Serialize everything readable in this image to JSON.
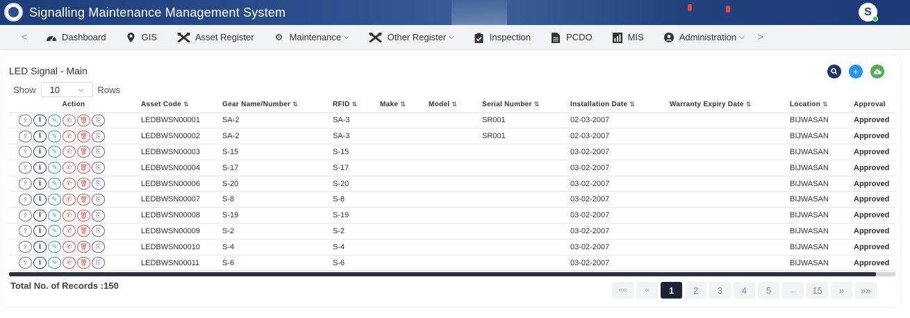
{
  "header": {
    "title": "Signalling Maintenance Management System",
    "avatar_letter": "S"
  },
  "nav": {
    "items": [
      {
        "label": "Dashboard",
        "icon": "dashboard-icon",
        "has_dropdown": false
      },
      {
        "label": "GIS",
        "icon": "map-pin-icon",
        "has_dropdown": false
      },
      {
        "label": "Asset Register",
        "icon": "tools-icon",
        "has_dropdown": false
      },
      {
        "label": "Maintenance",
        "icon": "gear-icon",
        "has_dropdown": true
      },
      {
        "label": "Other Register",
        "icon": "tools-icon",
        "has_dropdown": true
      },
      {
        "label": "Inspection",
        "icon": "clipboard-check-icon",
        "has_dropdown": false
      },
      {
        "label": "PCDO",
        "icon": "file-icon",
        "has_dropdown": false
      },
      {
        "label": "MIS",
        "icon": "report-icon",
        "has_dropdown": false
      },
      {
        "label": "Administration",
        "icon": "user-circle-icon",
        "has_dropdown": true
      }
    ],
    "prev_arrow": "<",
    "next_arrow": ">"
  },
  "panel": {
    "title": "LED Signal - Main",
    "show_label": "Show",
    "rows_label": "Rows",
    "rows_value": "10"
  },
  "colors": {
    "search_button": "#1d3768",
    "add_button": "#2196f3",
    "upload_button": "#4caf50",
    "approved": "#31c13c",
    "header_bg": "#2b4f8e"
  },
  "table": {
    "columns": [
      "Action",
      "Asset Code",
      "Gear Name/Number",
      "RFID",
      "Make",
      "Model",
      "Serial Number",
      "Installation Date",
      "Warranty Expiry Date",
      "Location",
      "Approval"
    ],
    "rows": [
      {
        "asset_code": "LEDBWSN00001",
        "gear": "SA-2",
        "rfid": "SA-3",
        "make": "",
        "model": "",
        "serial": "SR001",
        "install": "02-03-2007",
        "warranty": "",
        "location": "BIJWASAN",
        "approval": "Approved"
      },
      {
        "asset_code": "LEDBWSN00002",
        "gear": "SA-2",
        "rfid": "SA-3",
        "make": "",
        "model": "",
        "serial": "SR001",
        "install": "02-03-2007",
        "warranty": "",
        "location": "BIJWASAN",
        "approval": "Approved"
      },
      {
        "asset_code": "LEDBWSN00003",
        "gear": "S-15",
        "rfid": "S-15",
        "make": "",
        "model": "",
        "serial": "",
        "install": "03-02-2007",
        "warranty": "",
        "location": "BIJWASAN",
        "approval": "Approved"
      },
      {
        "asset_code": "LEDBWSN00004",
        "gear": "S-17",
        "rfid": "S-17",
        "make": "",
        "model": "",
        "serial": "",
        "install": "03-02-2007",
        "warranty": "",
        "location": "BIJWASAN",
        "approval": "Approved"
      },
      {
        "asset_code": "LEDBWSN00006",
        "gear": "S-20",
        "rfid": "S-20",
        "make": "",
        "model": "",
        "serial": "",
        "install": "03-02-2007",
        "warranty": "",
        "location": "BIJWASAN",
        "approval": "Approved"
      },
      {
        "asset_code": "LEDBWSN00007",
        "gear": "S-8",
        "rfid": "S-8",
        "make": "",
        "model": "",
        "serial": "",
        "install": "03-02-2007",
        "warranty": "",
        "location": "BIJWASAN",
        "approval": "Approved"
      },
      {
        "asset_code": "LEDBWSN00008",
        "gear": "S-19",
        "rfid": "S-19",
        "make": "",
        "model": "",
        "serial": "",
        "install": "03-02-2007",
        "warranty": "",
        "location": "BIJWASAN",
        "approval": "Approved"
      },
      {
        "asset_code": "LEDBWSN00009",
        "gear": "S-2",
        "rfid": "S-2",
        "make": "",
        "model": "",
        "serial": "",
        "install": "03-02-2007",
        "warranty": "",
        "location": "BIJWASAN",
        "approval": "Approved"
      },
      {
        "asset_code": "LEDBWSN00010",
        "gear": "S-4",
        "rfid": "S-4",
        "make": "",
        "model": "",
        "serial": "",
        "install": "03-02-2007",
        "warranty": "",
        "location": "BIJWASAN",
        "approval": "Approved"
      },
      {
        "asset_code": "LEDBWSN00011",
        "gear": "S-6",
        "rfid": "S-6",
        "make": "",
        "model": "",
        "serial": "",
        "install": "03-02-2007",
        "warranty": "",
        "location": "BIJWASAN",
        "approval": "Approved"
      }
    ]
  },
  "footer": {
    "total_label": "Total No. of Records :150",
    "pager": [
      "««",
      "«",
      "1",
      "2",
      "3",
      "4",
      "5",
      "...",
      "15",
      "»",
      "»»"
    ],
    "active_page": "1"
  }
}
